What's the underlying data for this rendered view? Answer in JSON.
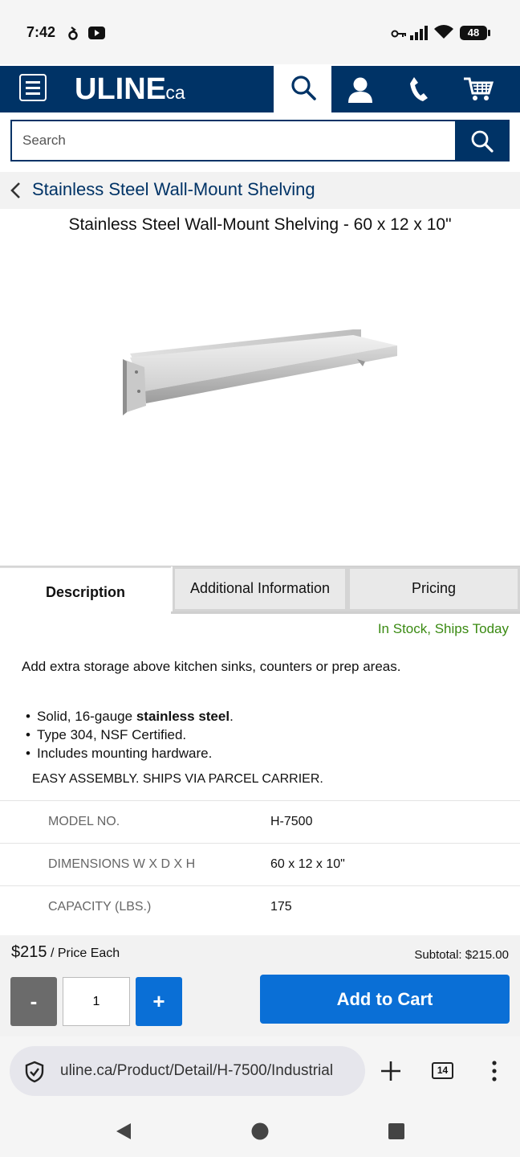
{
  "status_bar": {
    "time": "7:42",
    "battery": "48",
    "icons": [
      "notification-icon",
      "youtube-icon",
      "key-icon",
      "signal-icon",
      "wifi-icon",
      "battery-icon"
    ]
  },
  "header": {
    "logo": "ULINE",
    "logo_suffix": ".ca",
    "icons": [
      "menu-icon",
      "search-icon",
      "account-icon",
      "phone-icon",
      "cart-icon"
    ],
    "brand_color": "#003366"
  },
  "search": {
    "placeholder": "Search"
  },
  "breadcrumb": {
    "label": "Stainless Steel Wall-Mount Shelving"
  },
  "product": {
    "title": "Stainless Steel Wall-Mount Shelving - 60 x 12 x 10\"",
    "image": "stainless-steel-shelf-image"
  },
  "tabs": [
    {
      "label": "Description",
      "active": true
    },
    {
      "label": "Additional Information",
      "active": false
    },
    {
      "label": "Pricing",
      "active": false
    }
  ],
  "description": {
    "stock": "In Stock, Ships Today",
    "stock_color": "#3a8a12",
    "intro": "Add extra storage above kitchen sinks, counters or prep areas.",
    "bullet_1_prefix": "Solid, 16-gauge ",
    "bullet_1_bold": "stainless steel",
    "bullet_1_suffix": ".",
    "bullet_2": "Type 304, NSF Certified.",
    "bullet_3": "Includes mounting hardware.",
    "assembly": "EASY ASSEMBLY. SHIPS VIA PARCEL CARRIER."
  },
  "specs": [
    {
      "label": "MODEL NO.",
      "value": "H-7500"
    },
    {
      "label": "DIMENSIONS W X D X H",
      "value": "60 x 12 x 10\""
    },
    {
      "label": "CAPACITY (LBS.)",
      "value": "175"
    }
  ],
  "purchase": {
    "price": "$215",
    "price_unit": " / Price Each",
    "subtotal": "Subtotal: $215.00",
    "minus": "-",
    "quantity": "1",
    "plus": "+",
    "add_to_cart": "Add to Cart",
    "accent": "#0a6fd6"
  },
  "browser": {
    "url": "uline.ca/Product/Detail/H-7500/Industrial",
    "tab_count": "14",
    "icons": [
      "shield-icon",
      "new-tab-icon",
      "tabs-icon",
      "more-icon"
    ]
  },
  "nav": {
    "icons": [
      "back-icon",
      "home-icon",
      "recents-icon"
    ]
  }
}
